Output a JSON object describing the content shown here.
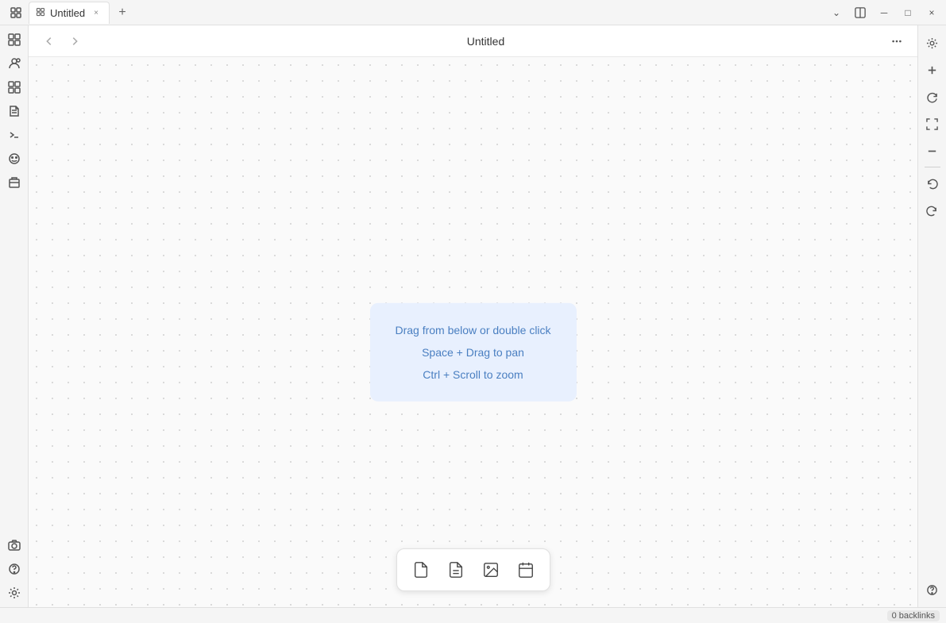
{
  "titlebar": {
    "tab_title": "Untitled",
    "tab_icon": "⬡",
    "close_label": "×",
    "add_tab_label": "+",
    "dropdown_label": "⌄",
    "split_label": "⧉",
    "minimize_label": "─",
    "maximize_label": "□",
    "window_close_label": "×"
  },
  "page": {
    "title": "Untitled"
  },
  "left_sidebar": {
    "icons": [
      {
        "name": "apps-icon",
        "symbol": "⊞",
        "tooltip": "Apps"
      },
      {
        "name": "people-icon",
        "symbol": "⚇",
        "tooltip": "People"
      },
      {
        "name": "blocks-icon",
        "symbol": "⊞",
        "tooltip": "Blocks"
      },
      {
        "name": "pages-icon",
        "symbol": "⎗",
        "tooltip": "Pages"
      },
      {
        "name": "terminal-icon",
        "symbol": "⌘",
        "tooltip": "Terminal"
      },
      {
        "name": "emoji-icon",
        "symbol": "☺",
        "tooltip": "Emoji"
      },
      {
        "name": "package-icon",
        "symbol": "⊟",
        "tooltip": "Package"
      }
    ],
    "bottom_icons": [
      {
        "name": "camera-icon",
        "symbol": "⊡",
        "tooltip": "Camera"
      },
      {
        "name": "help-icon",
        "symbol": "?",
        "tooltip": "Help"
      },
      {
        "name": "settings-icon",
        "symbol": "⚙",
        "tooltip": "Settings"
      }
    ]
  },
  "canvas": {
    "hint": {
      "line1": "Drag from below or double click",
      "line2": "Space + Drag to pan",
      "line3": "Ctrl + Scroll to zoom"
    }
  },
  "bottom_toolbar": {
    "tools": [
      {
        "name": "new-note-tool",
        "symbol": "🗒",
        "label": "New note"
      },
      {
        "name": "new-doc-tool",
        "symbol": "📄",
        "label": "New document"
      },
      {
        "name": "new-image-tool",
        "symbol": "🖼",
        "label": "New image"
      },
      {
        "name": "new-event-tool",
        "symbol": "📅",
        "label": "New event"
      }
    ]
  },
  "right_toolbar": {
    "icons": [
      {
        "name": "settings-right-icon",
        "symbol": "⚙",
        "tooltip": "Settings"
      },
      {
        "name": "zoom-in-icon",
        "symbol": "+",
        "tooltip": "Zoom in"
      },
      {
        "name": "refresh-icon",
        "symbol": "↻",
        "tooltip": "Refresh"
      },
      {
        "name": "fit-icon",
        "symbol": "⤢",
        "tooltip": "Fit"
      },
      {
        "name": "zoom-out-icon",
        "symbol": "−",
        "tooltip": "Zoom out"
      },
      {
        "name": "undo-icon",
        "symbol": "↺",
        "tooltip": "Undo"
      },
      {
        "name": "redo-icon",
        "symbol": "↻",
        "tooltip": "Redo"
      },
      {
        "name": "help-right-icon",
        "symbol": "?",
        "tooltip": "Help"
      }
    ]
  },
  "status_bar": {
    "backlinks": "0 backlinks"
  }
}
